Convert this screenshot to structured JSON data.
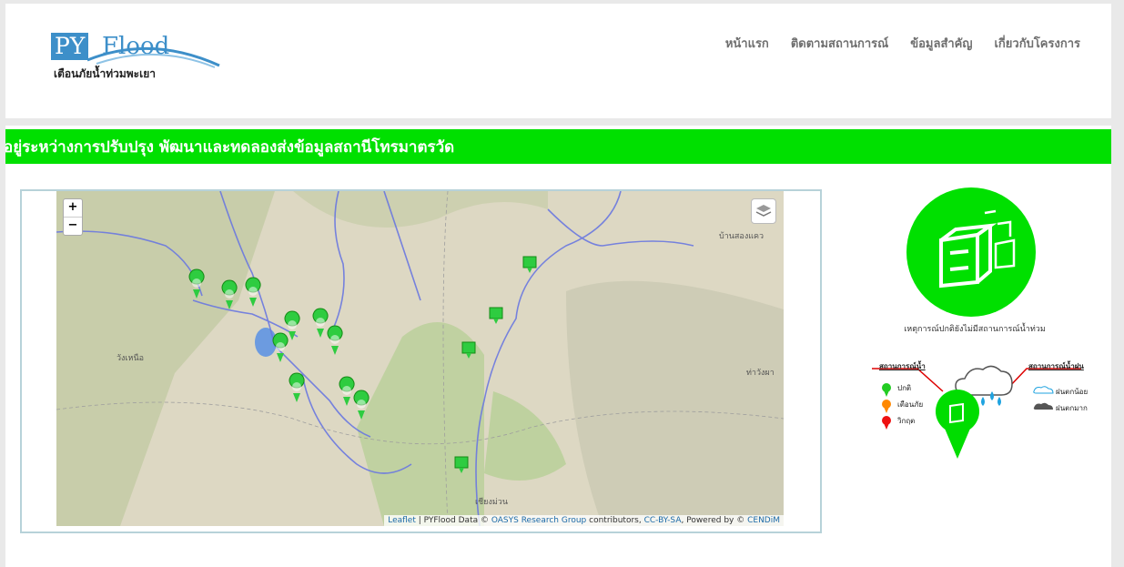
{
  "logo": {
    "py": "PY",
    "flood": "Flood",
    "tagline": "เตือนภัยน้ำท่วมพะเยา"
  },
  "nav": {
    "items": [
      "หน้าแรก",
      "ติดตามสถานการณ์",
      "ข้อมูลสำคัญ",
      "เกี่ยวกับโครงการ"
    ]
  },
  "banner": {
    "text": "อยู่ระหว่างการปรับปรุง พัฒนาและทดลองส่งข้อมูลสถานีโทรมาตรวัด"
  },
  "map": {
    "zoom_in": "+",
    "zoom_out": "−",
    "labels": {
      "west": "วังเหนือ",
      "east": "ท่าวังผา",
      "south": "เชียงม่วน",
      "north_east": "บ้านสองแคว"
    },
    "attribution": {
      "leaflet": "Leaflet",
      "text1": " | PYFlood Data © ",
      "oasys": "OASYS Research Group",
      "text2": " contributors, ",
      "license": "CC-BY-SA",
      "text3": ", Powered by © ",
      "cendim": "CENDiM"
    }
  },
  "status": {
    "text": "เหตุการณ์ปกติยังไม่มีสถานการณ์น้ำท่วม"
  },
  "legend": {
    "water_title": "สถานการณ์น้ำ",
    "rain_title": "สถานการณ์น้ำฝน",
    "normal": "ปกติ",
    "warning": "เตือนภัย",
    "critical": "วิกฤต",
    "light_rain": "ฝนตกน้อย",
    "heavy_rain": "ฝนตกมาก"
  },
  "colors": {
    "banner": "#00e000",
    "normal": "#22cc22",
    "warning": "#ff8800",
    "critical": "#ee1111",
    "logo": "#3d8fc9"
  }
}
